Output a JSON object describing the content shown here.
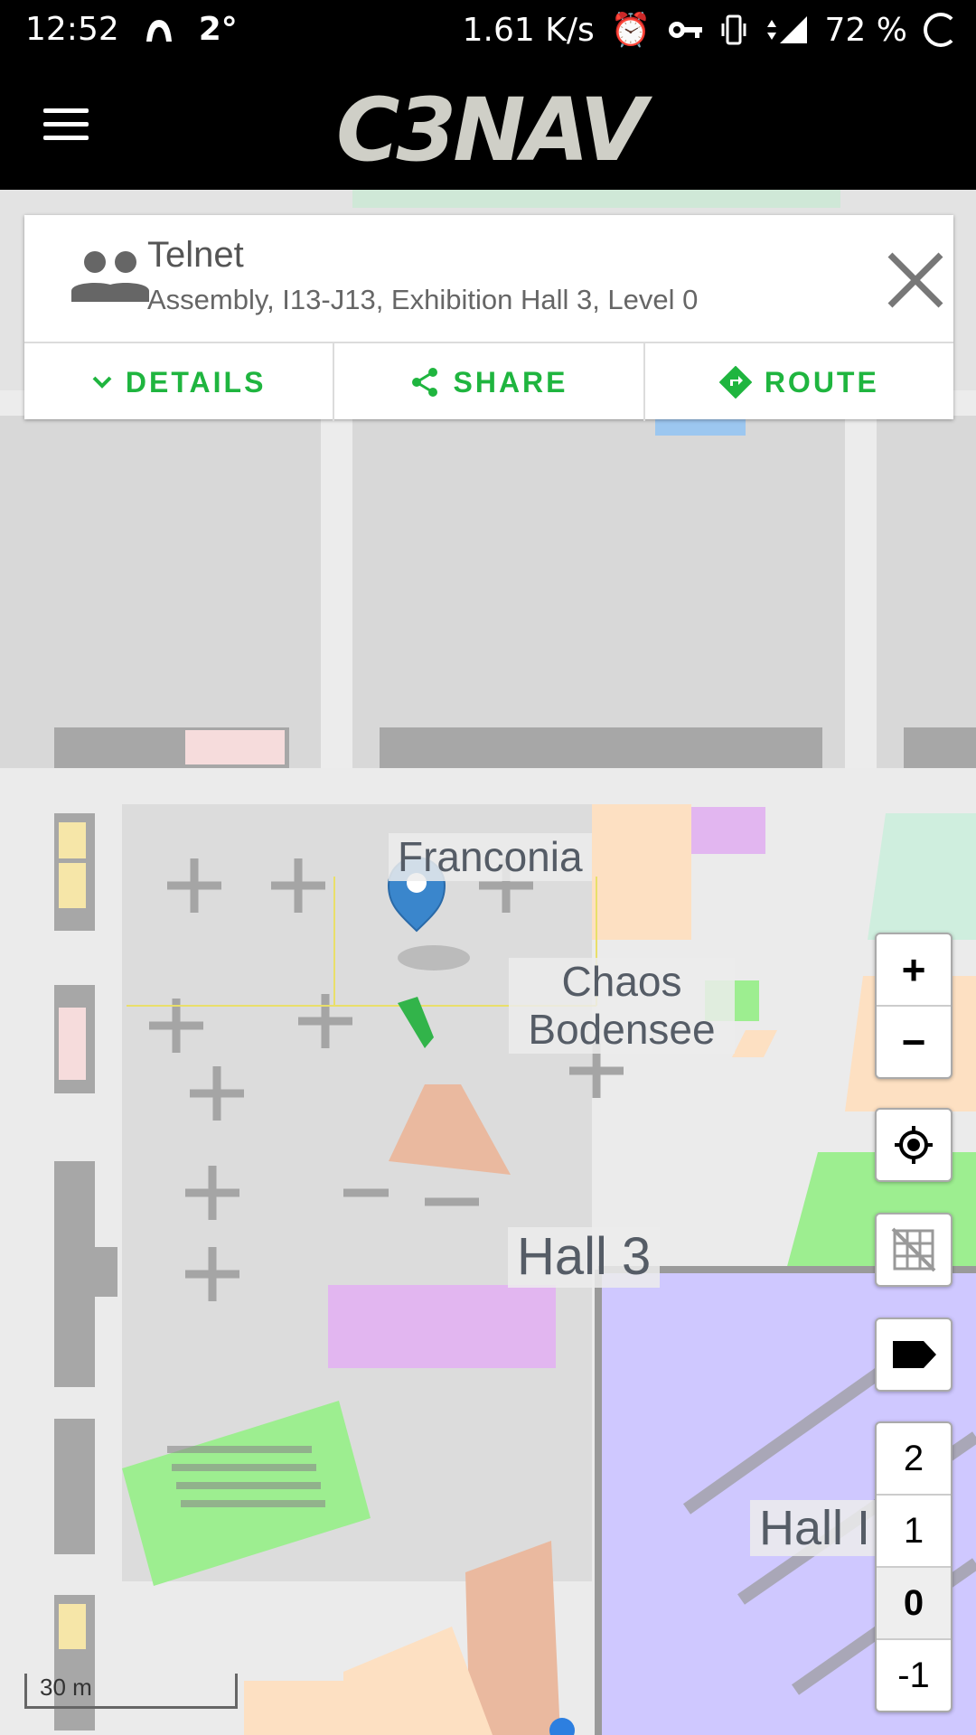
{
  "status_bar": {
    "time": "12:52",
    "temperature": "2°",
    "speed": "1.61 K/s",
    "battery": "72 %"
  },
  "app": {
    "title": "C3NAV"
  },
  "card": {
    "title": "Telnet",
    "subtitle": "Assembly, I13-J13, Exhibition Hall 3, Level 0",
    "buttons": {
      "details": "DETAILS",
      "share": "SHARE",
      "route": "ROUTE"
    }
  },
  "map": {
    "labels": {
      "franconia": "Franconia",
      "chaos_bodensee": "Chaos Bodensee",
      "hall3": "Hall 3",
      "hall_right": "Hall I g"
    },
    "scale": "30 m"
  },
  "controls": {
    "zoom_in": "+",
    "zoom_out": "−",
    "levels": [
      "2",
      "1",
      "0",
      "-1"
    ],
    "active_level": "0"
  },
  "colors": {
    "accent": "#1fb53f",
    "hall_purple": "#cfc8ff",
    "green_area": "#9dee90"
  }
}
